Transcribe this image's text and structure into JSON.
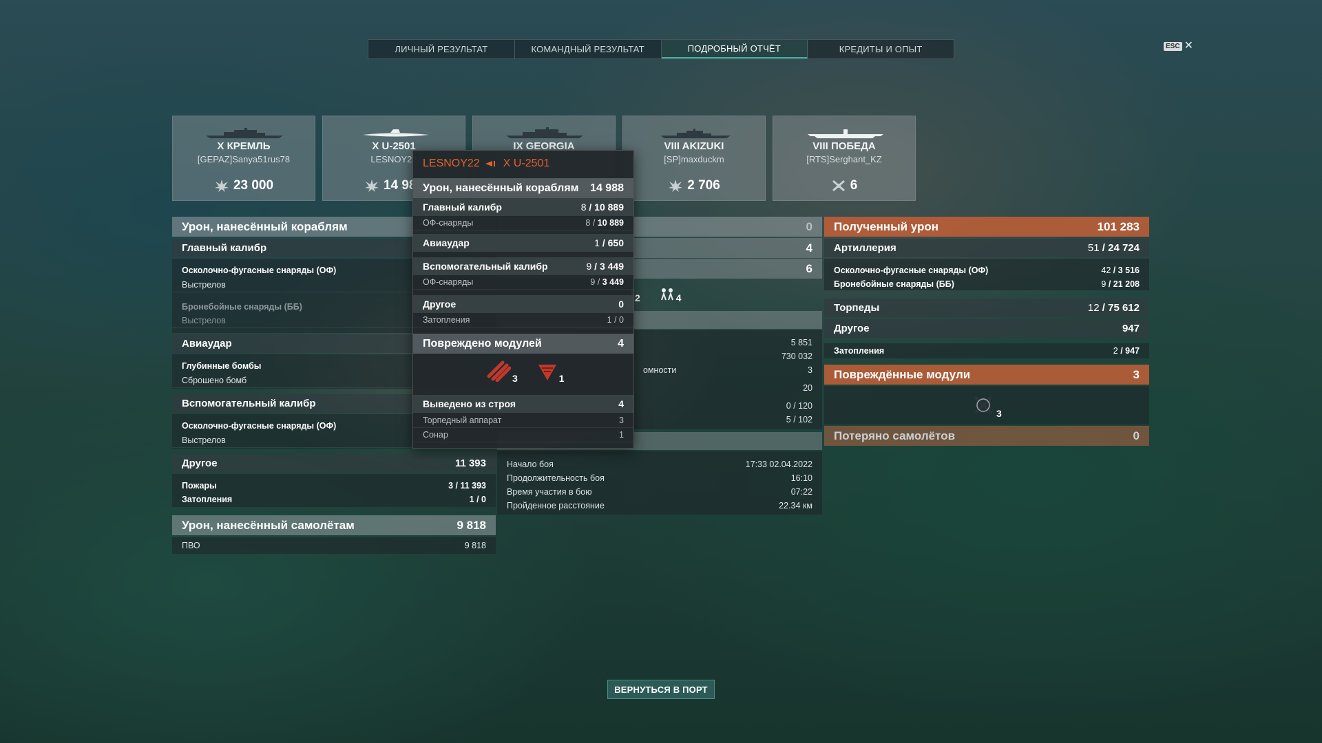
{
  "tabs": [
    "ЛИЧНЫЙ РЕЗУЛЬТАТ",
    "КОМАНДНЫЙ РЕЗУЛЬТАТ",
    "ПОДРОБНЫЙ ОТЧЁТ",
    "КРЕДИТЫ И ОПЫТ"
  ],
  "active_tab": "ПОДРОБНЫЙ ОТЧЁТ",
  "close": {
    "key": "ESC",
    "symbol": "✕"
  },
  "ships": [
    {
      "name": "X КРЕМЛЬ",
      "player": "[GEPAZ]Sanya51rus78",
      "score": "23 000",
      "icon": "ribbon-icon"
    },
    {
      "name": "X U-2501",
      "player": "LESNOY22",
      "score": "14 988",
      "icon": "ribbon-icon"
    },
    {
      "name": "IX GEORGIA",
      "player": "",
      "score": "",
      "icon": "ribbon-icon"
    },
    {
      "name": "VIII AKIZUKI",
      "player": "[SP]maxduckm",
      "score": "2 706",
      "icon": "ribbon-icon"
    },
    {
      "name": "VIII ПОБЕДА",
      "player": "[RTS]Serghant_KZ",
      "score": "6",
      "icon": "plane-kill-icon"
    }
  ],
  "left": {
    "header": "Урон, нанесённый кораблям",
    "main_caliber": "Главный калибр",
    "he_label": "Осколочно-фугасные снаряды (ОФ)",
    "shots_label": "Выстрелов",
    "ap_label": "Бронебойные снаряды (ББ)",
    "ap_shots_label": "Выстрелов",
    "airstrike": "Авиаудар",
    "depth_bombs": "Глубинные бомбы",
    "bombs_dropped": "Сброшено бомб",
    "secondary": "Вспомогательный калибр",
    "sec_he": "Осколочно-фугасные снаряды (ОФ)",
    "sec_shots": "Выстрелов",
    "other": "Другое",
    "other_value": "11 393",
    "fires": "Пожары",
    "fires_hits": "3",
    "fires_dmg": "11 393",
    "floods": "Затопления",
    "floods_hits": "1",
    "floods_dmg": "0",
    "planes_header": "Урон, нанесённый самолётам",
    "planes_value": "9 818",
    "aa_label": "ПВО",
    "aa_value": "9 818"
  },
  "middle": {
    "row1_value": "0",
    "row2_value": "4",
    "row3_value": "6",
    "icon_count_1": "2",
    "icon_count_2": "4",
    "values": [
      "5 851",
      "730 032"
    ],
    "partial_label": "ремонтопригодности",
    "partial_label_visible": "омности",
    "partial_value": "3",
    "val_20": "20",
    "val_0_120": "0 / 120",
    "val_5_102": "5 / 102",
    "battle_start_label": "Начало боя",
    "battle_start_value": "17:33  02.04.2022",
    "duration_label": "Продолжительность боя",
    "duration_value": "16:10",
    "participation_label": "Время участия в бою",
    "participation_value": "07:22",
    "distance_label": "Пройденное расстояние",
    "distance_value": "22.34 км"
  },
  "right": {
    "received": "Полученный урон",
    "received_value": "101 283",
    "artillery": "Артиллерия",
    "artillery_hits": "51",
    "artillery_dmg": "24 724",
    "he": "Осколочно-фугасные снаряды (ОФ)",
    "he_hits": "42",
    "he_dmg": "3 516",
    "ap": "Бронебойные снаряды (ББ)",
    "ap_hits": "9",
    "ap_dmg": "21 208",
    "torpedoes": "Торпеды",
    "torp_hits": "12",
    "torp_dmg": "75 612",
    "other": "Другое",
    "other_value": "947",
    "floods": "Затопления",
    "floods_hits": "2",
    "floods_dmg": "947",
    "modules": "Повреждённые модули",
    "modules_value": "3",
    "module_icon_count": "3",
    "planes_lost": "Потеряно самолётов",
    "planes_lost_value": "0"
  },
  "tooltip": {
    "player": "LESNOY22",
    "ship": "X U-2501",
    "header": "Урон, нанесённый кораблям",
    "header_value": "14 988",
    "main_caliber": "Главный калибр",
    "main_hits": "8",
    "main_dmg": "10 889",
    "he": "ОФ-снаряды",
    "he_hits": "8",
    "he_dmg": "10 889",
    "airstrike": "Авиаудар",
    "air_hits": "1",
    "air_dmg": "650",
    "secondary": "Вспомогательный калибр",
    "sec_hits": "9",
    "sec_dmg": "3 449",
    "sec_he": "ОФ-снаряды",
    "sec_he_hits": "9",
    "sec_he_dmg": "3 449",
    "other": "Другое",
    "other_value": "0",
    "floods": "Затопления",
    "floods_value": "1 / 0",
    "modules": "Повреждено модулей",
    "modules_value": "4",
    "icon_torp_count": "3",
    "icon_sonar_count": "1",
    "disabled": "Выведено из строя",
    "disabled_value": "4",
    "torp_tube": "Торпедный аппарат",
    "torp_tube_value": "3",
    "sonar": "Сонар",
    "sonar_value": "1"
  },
  "back_button": "ВЕРНУТЬСЯ В ПОРТ",
  "colors": {
    "accent": "#3fb3a5",
    "orange": "#e2602b",
    "orange_header": "#be5f37"
  }
}
